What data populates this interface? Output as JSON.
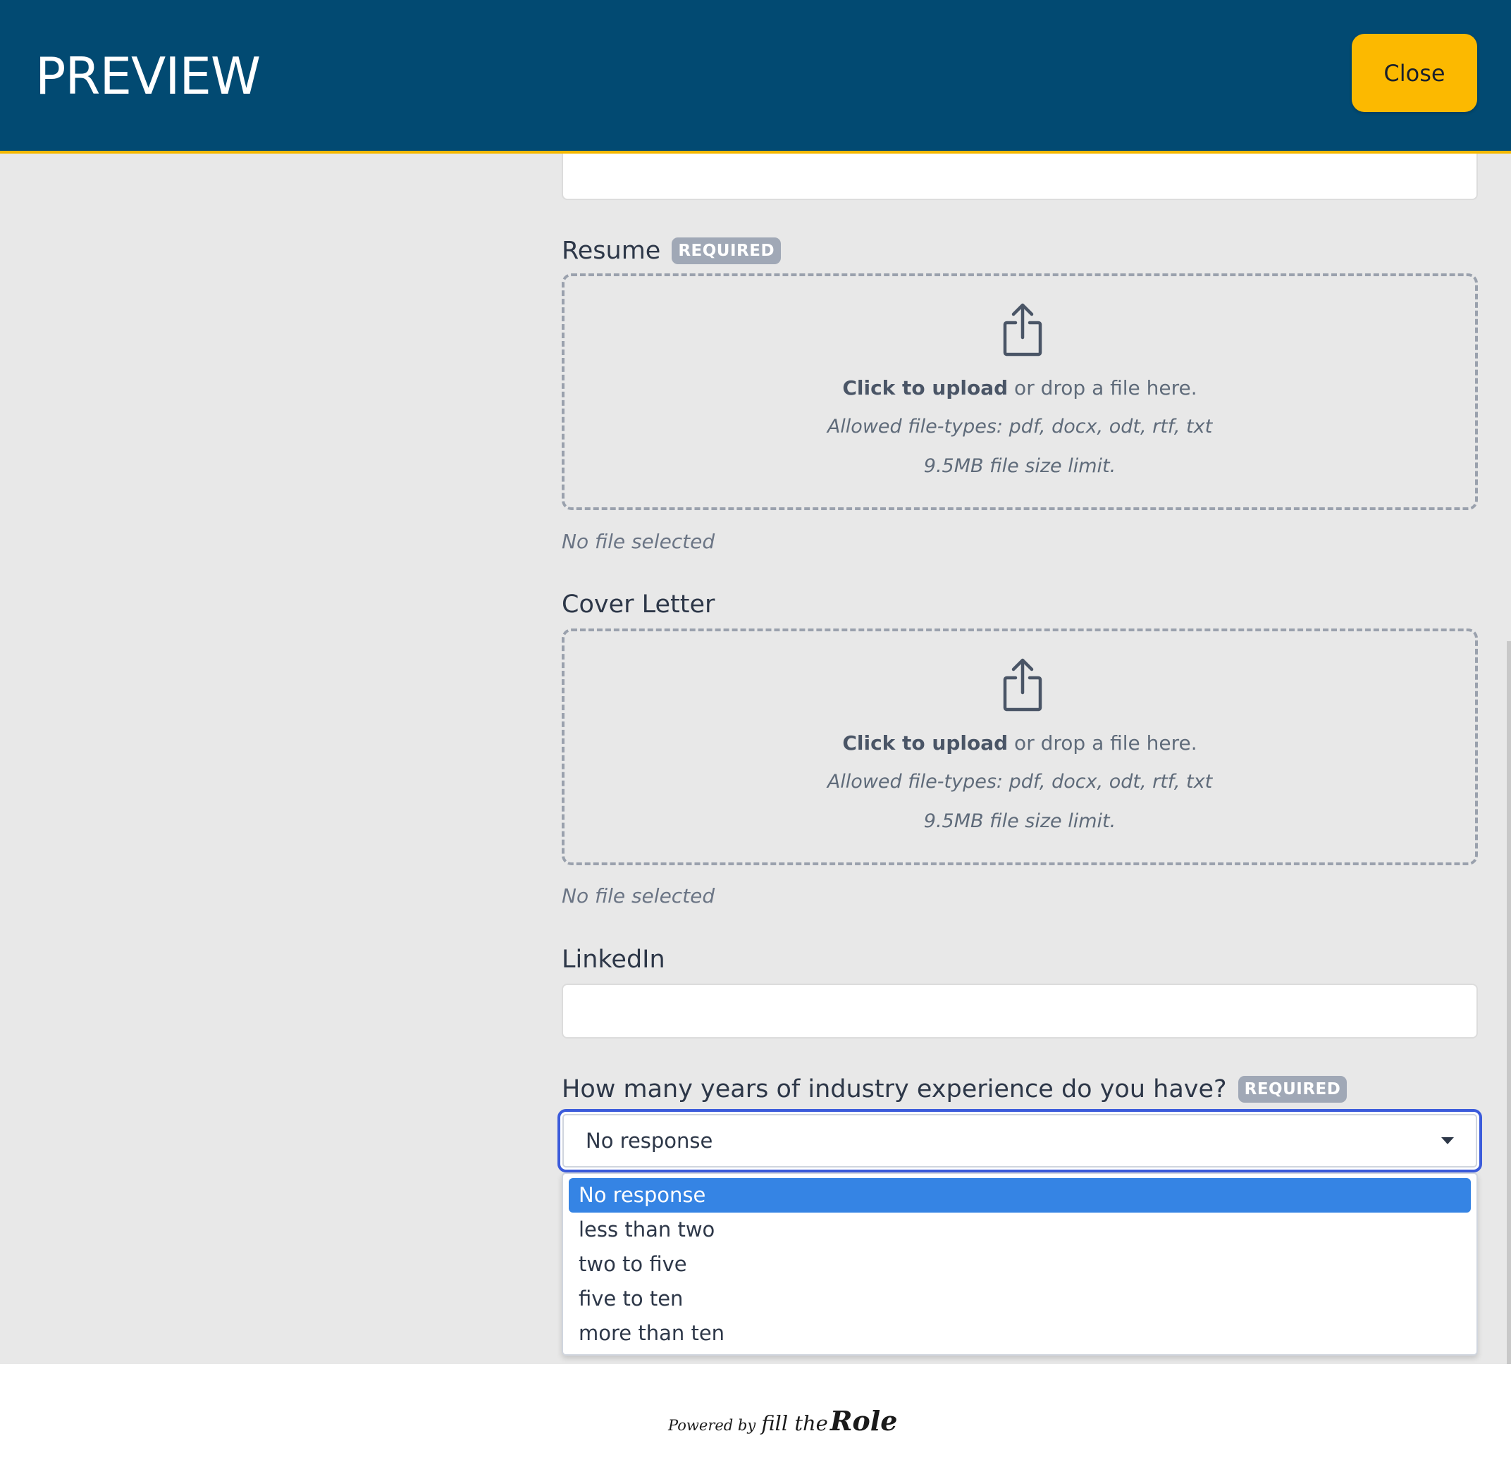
{
  "header": {
    "title": "PREVIEW",
    "close_label": "Close"
  },
  "resume": {
    "label": "Resume",
    "badge": "REQUIRED",
    "upload_bold": "Click to upload",
    "upload_rest": " or drop a file here.",
    "file_types": "Allowed file-types: pdf, docx, odt, rtf, txt",
    "size_limit": "9.5MB file size limit.",
    "status": "No file selected"
  },
  "cover_letter": {
    "label": "Cover Letter",
    "upload_bold": "Click to upload",
    "upload_rest": " or drop a file here.",
    "file_types": "Allowed file-types: pdf, docx, odt, rtf, txt",
    "size_limit": "9.5MB file size limit.",
    "status": "No file selected"
  },
  "linkedin": {
    "label": "LinkedIn",
    "value": ""
  },
  "experience": {
    "label": "How many years of industry experience do you have?",
    "badge": "REQUIRED",
    "selected": "No response",
    "options": [
      "No response",
      "less than two",
      "two to five",
      "five to ten",
      "more than ten"
    ]
  },
  "footer": {
    "powered_by": "Powered by",
    "brand_fill": "fill the",
    "brand_role": "Role"
  },
  "colors": {
    "header_bg": "#024a72",
    "accent": "#fcb900",
    "selected_option": "#3584e4",
    "focus_ring": "#3b5bdb"
  }
}
